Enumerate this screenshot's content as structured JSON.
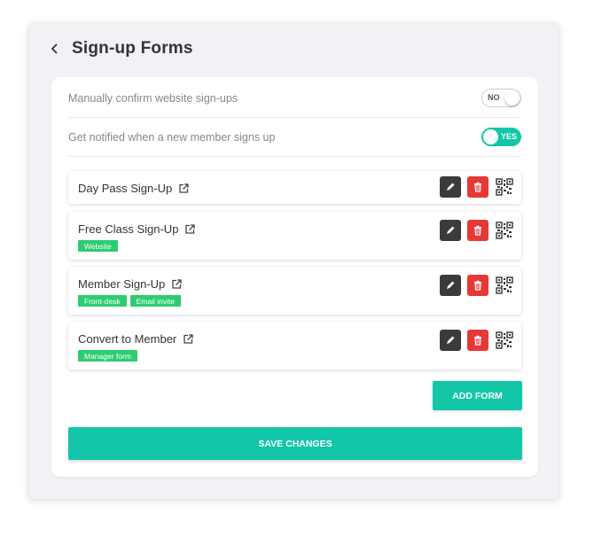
{
  "page": {
    "title": "Sign-up Forms"
  },
  "settings": [
    {
      "label": "Manually confirm website sign-ups",
      "toggle_text": "NO",
      "on": false
    },
    {
      "label": "Get notified when a new member signs up",
      "toggle_text": "YES",
      "on": true
    }
  ],
  "forms": [
    {
      "name": "Day Pass Sign-Up",
      "tags": []
    },
    {
      "name": "Free Class Sign-Up",
      "tags": [
        "Website"
      ]
    },
    {
      "name": "Member Sign-Up",
      "tags": [
        "Front-desk",
        "Email invite"
      ]
    },
    {
      "name": "Convert to Member",
      "tags": [
        "Manager form"
      ]
    }
  ],
  "buttons": {
    "add_form": "ADD FORM",
    "save_changes": "SAVE CHANGES"
  },
  "colors": {
    "accent": "#13c6a8",
    "tag": "#2ecc71",
    "delete": "#e53935",
    "edit": "#3b3b3b"
  },
  "icons": {
    "back": "chevron-left-icon",
    "external": "external-link-icon",
    "edit": "pencil-icon",
    "delete": "trash-icon",
    "qr": "qr-code-icon"
  }
}
